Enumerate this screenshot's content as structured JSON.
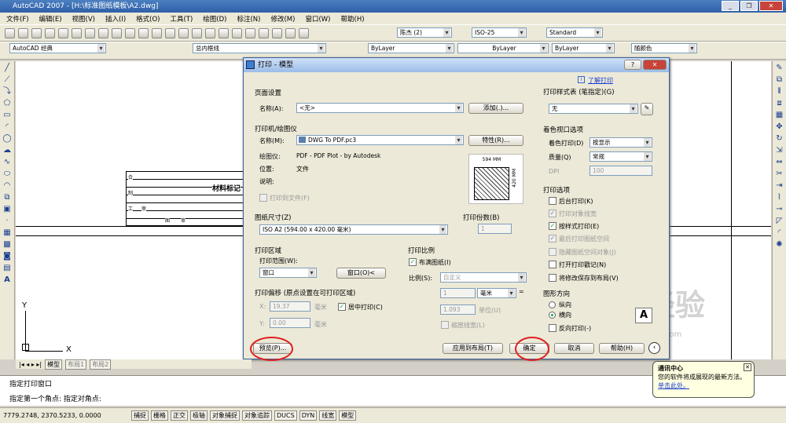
{
  "app": {
    "title": "AutoCAD 2007 - [H:\\标准图纸模板\\A2.dwg]"
  },
  "menu": [
    "文件(F)",
    "编辑(E)",
    "视图(V)",
    "插入(I)",
    "格式(O)",
    "工具(T)",
    "绘图(D)",
    "标注(N)",
    "修改(M)",
    "窗口(W)",
    "帮助(H)"
  ],
  "toolbar": {
    "text_style": "陈杰 (2)",
    "dim_style": "ISO-25",
    "table_style": "Standard",
    "workspace": "AutoCAD 经典",
    "layer": "总内框线",
    "linetype_color": "ByLayer",
    "linetype": "ByLayer",
    "lineweight": "ByLayer",
    "plot_style": "随颜色"
  },
  "drawing": {
    "table_title": "材料标记",
    "axis_y": "Y",
    "axis_x": "X",
    "small_labels": [
      "合",
      "制",
      "工",
      "审",
      "图",
      "审"
    ]
  },
  "layout_tabs": [
    "模型",
    "布局1",
    "布局2"
  ],
  "dialog": {
    "title": "打印 - 模型",
    "help_link": "了解打印",
    "page_setup": {
      "group": "页面设置",
      "name_label": "名称(A):",
      "name_value": "<无>",
      "add_button": "添加(.)..."
    },
    "printer": {
      "group": "打印机/绘图仪",
      "name_label": "名称(M):",
      "name_value": "DWG To PDF.pc3",
      "props_button": "特性(R)...",
      "plotter_label": "绘图仪:",
      "plotter_value": "PDF - PDF Plot - by Autodesk",
      "where_label": "位置:",
      "where_value": "文件",
      "desc_label": "说明:",
      "plot_to_file": "打印到文件(F)",
      "preview_width": "594 MM",
      "preview_height": "420 MM"
    },
    "paper_size": {
      "group": "图纸尺寸(Z)",
      "value": "ISO A2 (594.00 x 420.00 毫米)"
    },
    "copies": {
      "group": "打印份数(B)",
      "value": "1"
    },
    "plot_area": {
      "group": "打印区域",
      "what_label": "打印范围(W):",
      "what_value": "窗口",
      "window_button": "窗口(O)<"
    },
    "plot_scale": {
      "group": "打印比例",
      "fit_paper": "布满图纸(I)",
      "scale_label": "比例(S):",
      "scale_value": "自定义",
      "value1": "1",
      "unit": "毫米",
      "value2": "1.093",
      "unit_label": "单位(U)",
      "scale_lineweights": "缩放线宽(L)"
    },
    "plot_offset": {
      "group": "打印偏移 (原点设置在可打印区域)",
      "x_label": "X:",
      "x_value": "19.37",
      "x_unit": "毫米",
      "center": "居中打印(C)",
      "y_label": "Y:",
      "y_value": "0.00",
      "y_unit": "毫米"
    },
    "plot_style_table": {
      "group": "打印样式表 (笔指定)(G)",
      "value": "无"
    },
    "shaded_viewport": {
      "group": "着色视口选项",
      "shade_label": "着色打印(D)",
      "shade_value": "按显示",
      "quality_label": "质量(Q)",
      "quality_value": "常规",
      "dpi_label": "DPI",
      "dpi_value": "100"
    },
    "plot_options": {
      "group": "打印选项",
      "items": [
        "后台打印(K)",
        "打印对象线宽",
        "按样式打印(E)",
        "最后打印图纸空间",
        "隐藏图纸空间对象(J)",
        "打开打印戳记(N)",
        "将修改保存到布局(V)"
      ]
    },
    "orientation": {
      "group": "图形方向",
      "portrait": "纵向",
      "landscape": "横向",
      "upside_down": "反向打印(-)"
    },
    "buttons": {
      "preview": "预览(P)...",
      "apply": "应用到布局(T)",
      "ok": "确定",
      "cancel": "取消",
      "help": "帮助(H)"
    }
  },
  "command": {
    "line1": "指定打印窗口",
    "line2": "指定第一个角点: 指定对角点:"
  },
  "status": {
    "coords": "7779.2748, 2370.5233, 0.0000",
    "buttons": [
      "捕捉",
      "栅格",
      "正交",
      "极轴",
      "对象捕捉",
      "对象追踪",
      "DUCS",
      "DYN",
      "线宽",
      "模型"
    ]
  },
  "balloon": {
    "title": "通讯中心",
    "body": "您的软件将成展现的最新方法。",
    "link": "单击此处。"
  },
  "watermark": "jingyan.baidu.com"
}
